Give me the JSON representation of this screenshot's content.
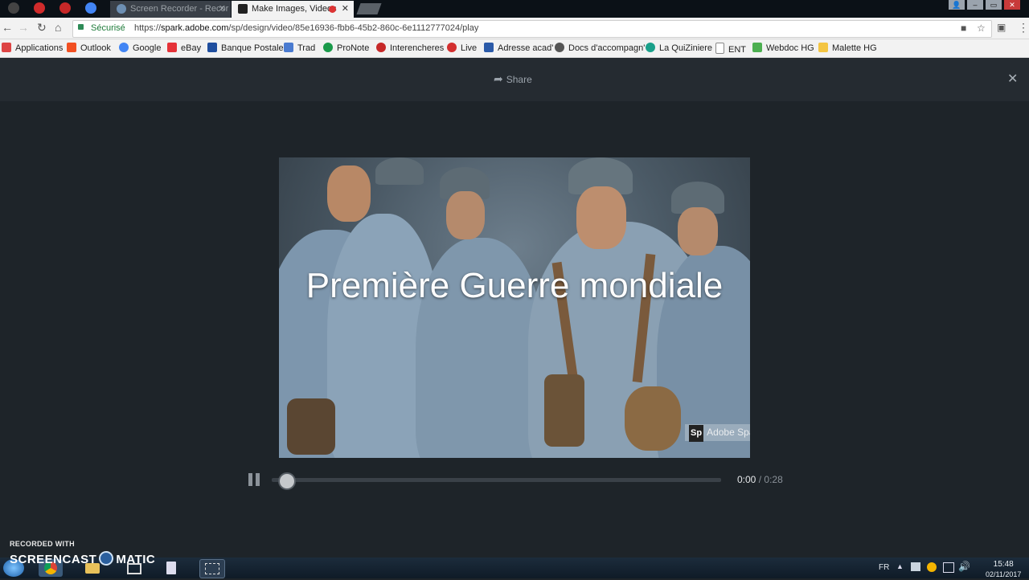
{
  "browser": {
    "tabs": [
      {
        "title": "Screen Recorder - Recor",
        "active": false
      },
      {
        "title": "Make Images, Videos",
        "active": true,
        "favicon": "Sp"
      }
    ],
    "address": {
      "secure_label": "Sécurisé",
      "url_scheme": "https://",
      "url_host": "spark.adobe.com",
      "url_path": "/sp/design/video/85e16936-fbb6-45b2-860c-6e1112777024/play"
    },
    "bookmarks": [
      {
        "label": "Applications",
        "icon": "apps-grid-icon",
        "color": "#d44"
      },
      {
        "label": "Outlook",
        "icon": "windows-icon",
        "color": "#f25022"
      },
      {
        "label": "Google",
        "icon": "google-icon",
        "color": "#4285f4"
      },
      {
        "label": "eBay",
        "icon": "ebay-icon",
        "color": "#e53238"
      },
      {
        "label": "Banque Postale",
        "icon": "bank-icon",
        "color": "#1f4e9e"
      },
      {
        "label": "Trad",
        "icon": "translate-icon",
        "color": "#4a7bd0"
      },
      {
        "label": "ProNote",
        "icon": "pronote-icon",
        "color": "#1a9a4a"
      },
      {
        "label": "Interencheres",
        "icon": "auction-icon",
        "color": "#c62828"
      },
      {
        "label": "Live",
        "icon": "live-icon",
        "color": "#d32f2f"
      },
      {
        "label": "Adresse acad'",
        "icon": "academy-icon",
        "color": "#2b5aa8"
      },
      {
        "label": "Docs d'accompagn'",
        "icon": "docs-icon",
        "color": "#555"
      },
      {
        "label": "La QuiZiniere",
        "icon": "quiz-icon",
        "color": "#1aa08a"
      },
      {
        "label": "ENT",
        "icon": "page-icon",
        "color": "#777"
      },
      {
        "label": "Webdoc HG",
        "icon": "webdoc-icon",
        "color": "#4caf50"
      },
      {
        "label": "Malette HG",
        "icon": "folder-icon",
        "color": "#f4c542"
      }
    ]
  },
  "player": {
    "share_label": "Share",
    "slide_title": "Première Guerre mondiale",
    "watermark_badge": "Sp",
    "watermark_text": "Adobe Spark",
    "time_current": "0:00",
    "time_sep": "/",
    "time_total": "0:28",
    "progress_fraction": 0.0
  },
  "recorder": {
    "recorded_with": "RECORDED WITH",
    "brand_left": "SCREENCAST",
    "brand_right": "MATIC"
  },
  "taskbar": {
    "language": "FR",
    "clock_time": "15:48",
    "clock_date": "02/11/2017"
  }
}
